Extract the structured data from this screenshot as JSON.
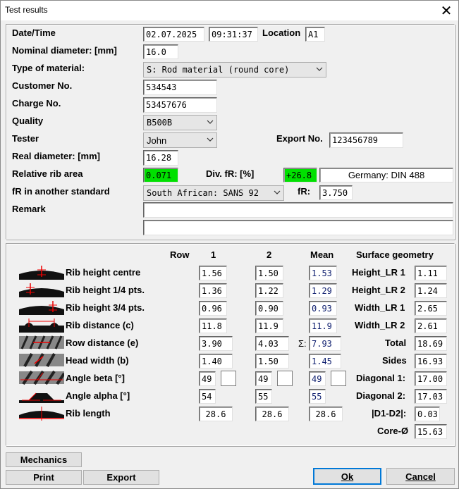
{
  "window": {
    "title": "Test results"
  },
  "top": {
    "date_time_label": "Date/Time",
    "date": "02.07.2025",
    "time": "09:31:37",
    "location_label": "Location",
    "location": "A1",
    "nominal_diameter_label": "Nominal diameter: [mm]",
    "nominal_diameter": "16.0",
    "type_of_material_label": "Type of material:",
    "type_of_material": "S: Rod material (round core)",
    "customer_no_label": "Customer No.",
    "customer_no": "534543",
    "charge_no_label": "Charge No.",
    "charge_no": "53457676",
    "quality_label": "Quality",
    "quality": "B500B",
    "tester_label": "Tester",
    "tester": "John",
    "export_no_label": "Export No.",
    "export_no": "123456789",
    "real_diameter_label": "Real diameter: [mm]",
    "real_diameter": "16.28",
    "relative_rib_area_label": "Relative rib area",
    "relative_rib_area": "0.071",
    "div_fr_label": "Div. fR: [%]",
    "div_fr": "+26.8",
    "standard": "Germany: DIN 488",
    "fr_other_label": "fR in another standard",
    "fr_other_standard": "South African: SANS 92",
    "fr_label": "fR:",
    "fr_value": "3.750",
    "remark_label": "Remark",
    "remark_line1": "",
    "remark_line2": ""
  },
  "measurements": {
    "headers": {
      "row": "Row",
      "col1": "1",
      "col2": "2",
      "mean": "Mean",
      "surface": "Surface geometry"
    },
    "rows": [
      {
        "label": "Rib height centre",
        "v1": "1.56",
        "v2": "1.50",
        "mean": "1.53"
      },
      {
        "label": "Rib height 1/4 pts.",
        "v1": "1.36",
        "v2": "1.22",
        "mean": "1.29"
      },
      {
        "label": "Rib height 3/4 pts.",
        "v1": "0.96",
        "v2": "0.90",
        "mean": "0.93"
      },
      {
        "label": "Rib distance (c)",
        "v1": "11.8",
        "v2": "11.9",
        "mean": "11.9"
      },
      {
        "label": "Row distance (e)",
        "v1": "3.90",
        "v2": "4.03",
        "sigma": "Σ:",
        "mean": "7.93"
      },
      {
        "label": "Head width (b)",
        "v1": "1.40",
        "v2": "1.50",
        "mean": "1.45"
      },
      {
        "label": "Angle beta [°]",
        "v1": "49",
        "v2": "49",
        "mean": "49"
      },
      {
        "label": "Angle alpha [°]",
        "v1": "54",
        "v2": "55",
        "mean": "55"
      },
      {
        "label": "Rib length",
        "v1": "28.6",
        "v2": "28.6",
        "mean": "28.6"
      }
    ],
    "surface": [
      {
        "label": "Height_LR 1",
        "value": "1.11"
      },
      {
        "label": "Height_LR 2",
        "value": "1.24"
      },
      {
        "label": "Width_LR 1",
        "value": "2.65"
      },
      {
        "label": "Width_LR 2",
        "value": "2.61"
      },
      {
        "label": "Total",
        "value": "18.69"
      },
      {
        "label": "Sides",
        "value": "16.93"
      },
      {
        "label": "Diagonal 1:",
        "value": "17.00"
      },
      {
        "label": "Diagonal 2:",
        "value": "17.03"
      },
      {
        "label": "|D1-D2|:",
        "value": "0.03"
      },
      {
        "label": "Core-Ø",
        "value": "15.63"
      }
    ]
  },
  "buttons": {
    "mechanics": "Mechanics",
    "print": "Print",
    "export": "Export",
    "ok": "Ok",
    "cancel": "Cancel"
  },
  "colors": {
    "green_highlight": "#00e000",
    "mean_text": "#102070",
    "rib_red": "#e00000"
  },
  "icons": {
    "rib_height_centre": "rib-height-centre-icon",
    "rib_height_quarter": "rib-height-quarter-icon",
    "rib_height_three_quarter": "rib-height-three-quarter-icon",
    "rib_distance": "rib-distance-icon",
    "row_distance": "row-distance-icon",
    "head_width": "head-width-icon",
    "angle_beta": "angle-beta-icon",
    "angle_alpha": "angle-alpha-icon",
    "rib_length": "rib-length-icon"
  }
}
